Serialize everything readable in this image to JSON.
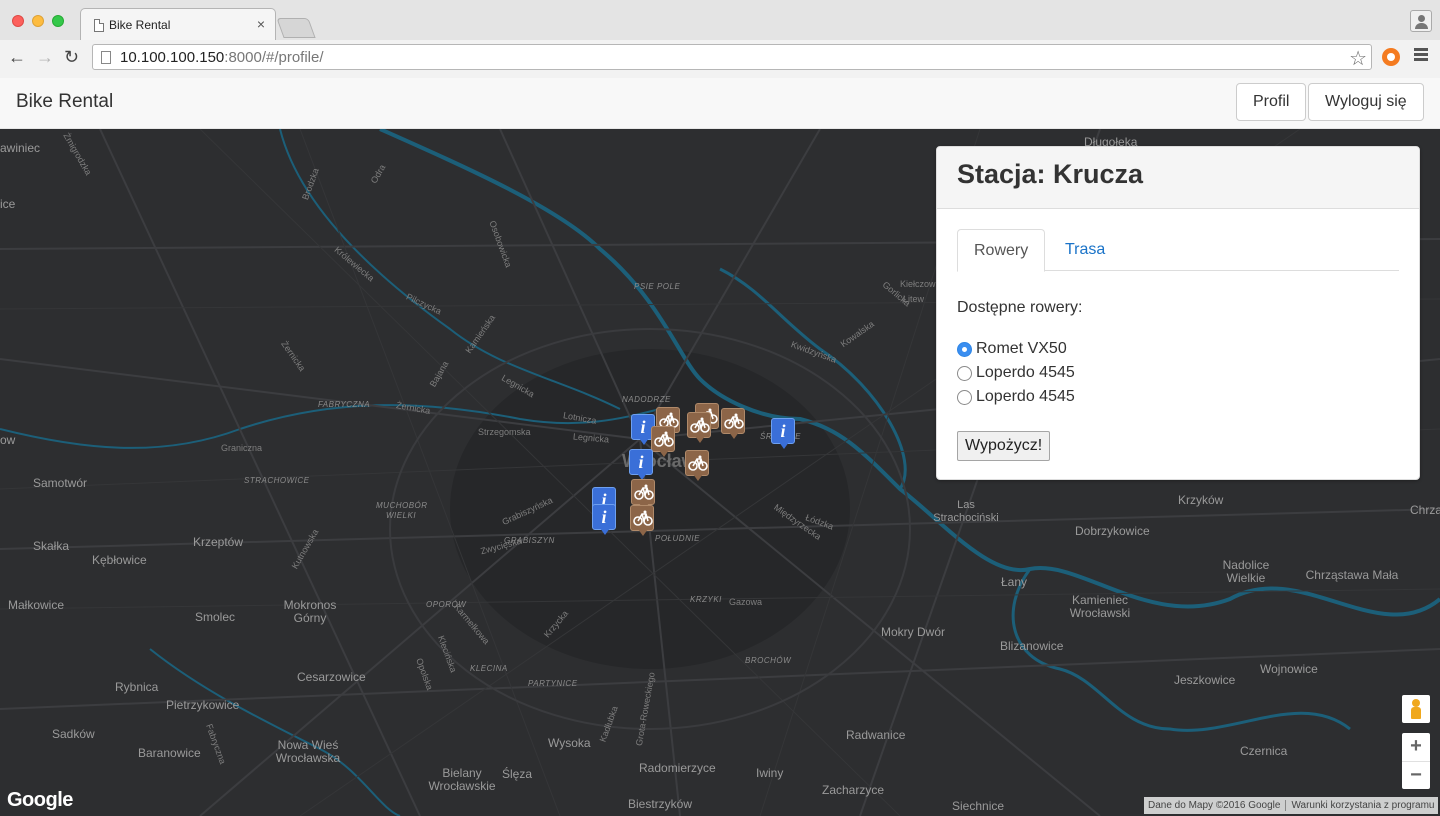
{
  "browser": {
    "tab_title": "Bike Rental",
    "tab_close": "×",
    "url_host": "10.100.100.150",
    "url_rest": ":8000/#/profile/",
    "back_glyph": "←",
    "forward_glyph": "→",
    "reload_glyph": "↻",
    "star_glyph": "☆"
  },
  "navbar": {
    "brand": "Bike Rental",
    "profile_label": "Profil",
    "logout_label": "Wyloguj się"
  },
  "panel": {
    "title": "Stacja: Krucza",
    "tabs": [
      {
        "label": "Rowery",
        "active": true
      },
      {
        "label": "Trasa",
        "active": false
      }
    ],
    "available_label": "Dostępne rowery:",
    "bikes": [
      {
        "name": "Romet VX50",
        "selected": true
      },
      {
        "name": "Loperdo 4545",
        "selected": false
      },
      {
        "name": "Loperdo 4545",
        "selected": false
      }
    ],
    "rent_button": "Wypożycz!"
  },
  "map": {
    "labels": [
      "awiniec",
      "ice",
      "ow",
      "Samotwór",
      "Skałka",
      "Kębłowice",
      "Krzeptów",
      "Małkowice",
      "Smolec",
      "Mokronos Górny",
      "Rybnica",
      "Cesarzowice",
      "Pietrzykowice",
      "Sadków",
      "Baranowice",
      "Nowa Wieś Wrocławska",
      "Bielany Wrocławskie",
      "Ślęza",
      "Wysoka",
      "Radomierzyce",
      "Iwiny",
      "Biestrzyków",
      "Zacharzyce",
      "Radwanice",
      "Siechnice",
      "Mokry Dwór",
      "Blizanowice",
      "Kamieniec Wrocławski",
      "Łany",
      "Dobrzykowice",
      "Krzyków",
      "Nadolice Wielkie",
      "Chrząstawa Mała",
      "Jeszkowice",
      "Wojnowice",
      "Czernica",
      "Chrza",
      "Długołęka",
      "Las Strachociński",
      "Wrocław"
    ],
    "districts": [
      "PSIE POLE",
      "NADODRZE",
      "FABRYCZNA",
      "STRACHOWICE",
      "MUCHOBÓR WIELKI",
      "GRABISZYN",
      "POŁUDNIE",
      "OPORÓW",
      "KRZYKI",
      "KLECINA",
      "PARTYNICE",
      "BROCHÓW",
      "ŚR...ŚCIE"
    ],
    "streets": [
      "Odra",
      "Żmigrodzka",
      "Osobowicka",
      "Brodzka",
      "Królewiecka",
      "Pilczycka",
      "Żernicka",
      "Bajana",
      "Legnicka",
      "Żernicka",
      "Graniczna",
      "Strzegomska",
      "Lotnicza",
      "Legnicka",
      "Grabiszyńska",
      "Klecińska",
      "Karmelkowa",
      "Krzycka",
      "Gazowa",
      "Kowalska",
      "Kwidzyńska",
      "Gorlicka",
      "Kiełczow",
      "Litew",
      "Międzyrzecka",
      "Kutnowska",
      "Opolska",
      "Grota-Roweckiego",
      "Kadłubka",
      "Fabryczna",
      "Łódzka",
      "Kamieńska",
      "Zwycięska"
    ],
    "google_logo": "Google",
    "attribution_data": "Dane do Mapy ©2016 Google",
    "attribution_terms": "Warunki korzystania z programu",
    "zoom_in": "+",
    "zoom_out": "−",
    "marker_info_glyph": "i"
  }
}
